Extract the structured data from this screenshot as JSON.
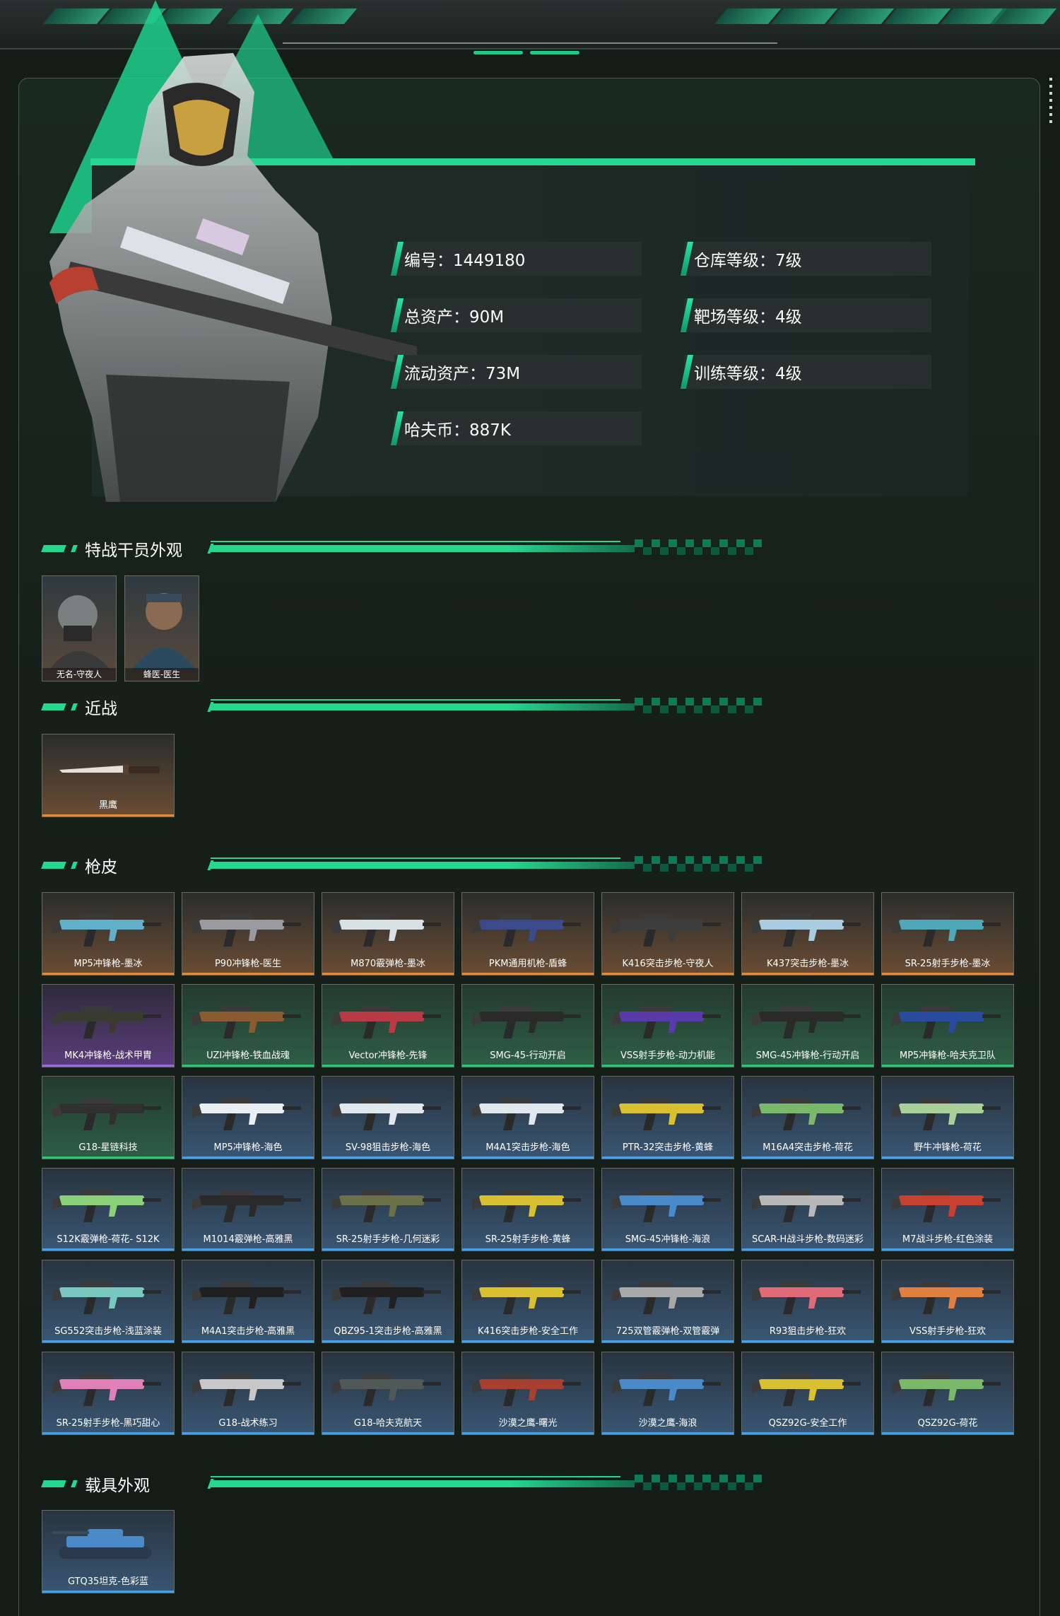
{
  "stats": [
    {
      "text": "编号：1449180"
    },
    {
      "text": "仓库等级：7级"
    },
    {
      "text": "总资产：90M"
    },
    {
      "text": "靶场等级：4级"
    },
    {
      "text": "流动资产：73M"
    },
    {
      "text": "训练等级：4级"
    },
    {
      "text": "哈夫币：887K"
    }
  ],
  "sections": {
    "operators": "特战干员外观",
    "melee": "近战",
    "guns": "枪皮",
    "vehicles": "载具外观"
  },
  "operators": [
    "无名-守夜人",
    "蜂医-医生"
  ],
  "melee": [
    {
      "name": "黑鹰",
      "rarity": "orange"
    }
  ],
  "guns": [
    {
      "name": "MP5冲锋枪-墨冰",
      "rarity": "orange",
      "color": "#5fb0c8"
    },
    {
      "name": "P90冲锋枪-医生",
      "rarity": "orange",
      "color": "#9a9aa0"
    },
    {
      "name": "M870霰弹枪-墨冰",
      "rarity": "orange",
      "color": "#d8e2e6"
    },
    {
      "name": "PKM通用机枪-盾蜂",
      "rarity": "orange",
      "color": "#3a4a8a"
    },
    {
      "name": "K416突击步枪-守夜人",
      "rarity": "orange",
      "color": "#3d3d3d"
    },
    {
      "name": "K437突击步枪-墨冰",
      "rarity": "orange",
      "color": "#a8cce0"
    },
    {
      "name": "SR-25射手步枪-墨冰",
      "rarity": "orange",
      "color": "#4fa8b8"
    },
    {
      "name": "MK4冲锋枪-战术甲胄",
      "rarity": "purple",
      "color": "#3a3a30"
    },
    {
      "name": "UZI冲锋枪-铁血战魂",
      "rarity": "green",
      "color": "#8a5a30"
    },
    {
      "name": "Vector冲锋枪-先锋",
      "rarity": "green",
      "color": "#b83a44"
    },
    {
      "name": "SMG-45-行动开启",
      "rarity": "green",
      "color": "#2a2a2a"
    },
    {
      "name": "VSS射手步枪-动力机能",
      "rarity": "green",
      "color": "#5a3aa8"
    },
    {
      "name": "SMG-45冲锋枪-行动开启",
      "rarity": "green",
      "color": "#2a2a2a"
    },
    {
      "name": "MP5冲锋枪-哈夫克卫队",
      "rarity": "green",
      "color": "#2a4aa0"
    },
    {
      "name": "G18-星链科技",
      "rarity": "green",
      "color": "#303030"
    },
    {
      "name": "MP5冲锋枪-海色",
      "rarity": "blue",
      "color": "#e8eef2"
    },
    {
      "name": "SV-98狙击步枪-海色",
      "rarity": "blue",
      "color": "#e0e8ee"
    },
    {
      "name": "M4A1突击步枪-海色",
      "rarity": "blue",
      "color": "#e0e8ee"
    },
    {
      "name": "PTR-32突击步枪-黄蜂",
      "rarity": "blue",
      "color": "#d8c030"
    },
    {
      "name": "M16A4突击步枪-荷花",
      "rarity": "blue",
      "color": "#7ab86a"
    },
    {
      "name": "野牛冲锋枪-荷花",
      "rarity": "blue",
      "color": "#a8d098"
    },
    {
      "name": "S12K霰弹枪-荷花- S12K",
      "rarity": "blue",
      "color": "#8ad078"
    },
    {
      "name": "M1014霰弹枪-高雅黑",
      "rarity": "blue",
      "color": "#2a2a2a"
    },
    {
      "name": "SR-25射手步枪-几何迷彩",
      "rarity": "blue",
      "color": "#6a7048"
    },
    {
      "name": "SR-25射手步枪-黄蜂",
      "rarity": "blue",
      "color": "#d8c030"
    },
    {
      "name": "SMG-45冲锋枪-海浪",
      "rarity": "blue",
      "color": "#4a8ac8"
    },
    {
      "name": "SCAR-H战斗步枪-数码迷彩",
      "rarity": "blue",
      "color": "#b8b8b8"
    },
    {
      "name": "M7战斗步枪-红色涂装",
      "rarity": "blue",
      "color": "#c84030"
    },
    {
      "name": "SG552突击步枪-浅蓝涂装",
      "rarity": "blue",
      "color": "#78c8c0"
    },
    {
      "name": "M4A1突击步枪-高雅黑",
      "rarity": "blue",
      "color": "#202020"
    },
    {
      "name": "QBZ95-1突击步枪-高雅黑",
      "rarity": "blue",
      "color": "#202020"
    },
    {
      "name": "K416突击步枪-安全工作",
      "rarity": "blue",
      "color": "#d8c030"
    },
    {
      "name": "725双管霰弹枪-双管霰弹",
      "rarity": "blue",
      "color": "#a8a8a8"
    },
    {
      "name": "R93狙击步枪-狂欢",
      "rarity": "blue",
      "color": "#e06a78"
    },
    {
      "name": "VSS射手步枪-狂欢",
      "rarity": "blue",
      "color": "#e08040"
    },
    {
      "name": "SR-25射手步枪-黑巧甜心",
      "rarity": "blue",
      "color": "#e080b8"
    },
    {
      "name": "G18-战术练习",
      "rarity": "blue",
      "color": "#c8c8c8"
    },
    {
      "name": "G18-哈夫克航天",
      "rarity": "blue",
      "color": "#505858"
    },
    {
      "name": "沙漠之鹰-曙光",
      "rarity": "blue",
      "color": "#a84030"
    },
    {
      "name": "沙漠之鹰-海浪",
      "rarity": "blue",
      "color": "#4a8ac8"
    },
    {
      "name": "QSZ92G-安全工作",
      "rarity": "blue",
      "color": "#d8c030"
    },
    {
      "name": "QSZ92G-荷花",
      "rarity": "blue",
      "color": "#7ab86a"
    }
  ],
  "vehicles": [
    {
      "name": "GTQ35坦克-色彩蓝",
      "rarity": "blue",
      "color": "#4a8ac8"
    }
  ]
}
